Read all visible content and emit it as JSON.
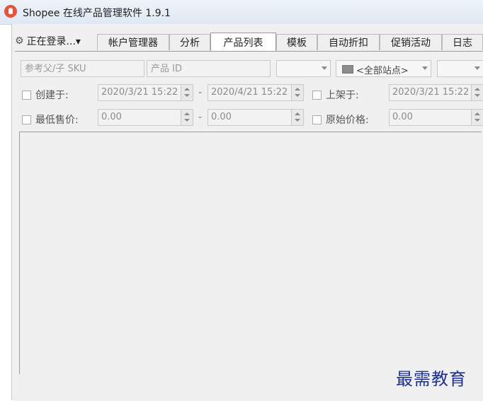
{
  "window": {
    "title": "Shopee 在线产品管理软件 1.9.1"
  },
  "menu": {
    "login_label": "正在登录...▾"
  },
  "tabs": [
    {
      "label": "帐户管理器",
      "active": false
    },
    {
      "label": "分析",
      "active": false
    },
    {
      "label": "产品列表",
      "active": true
    },
    {
      "label": "模板",
      "active": false
    },
    {
      "label": "自动折扣",
      "active": false
    },
    {
      "label": "促销活动",
      "active": false
    },
    {
      "label": "日志",
      "active": false
    }
  ],
  "filters": {
    "sku_placeholder": "参考父/子 SKU",
    "product_id_placeholder": "产品 ID",
    "site_select": "<全部站点>",
    "created_label": "创建于:",
    "created_from": "2020/3/21 15:22",
    "created_to": "2020/4/21 15:22",
    "listed_label": "上架于:",
    "listed_from": "2020/3/21 15:22",
    "min_price_label": "最低售价:",
    "min_price_from": "0.00",
    "min_price_to": "0.00",
    "orig_price_label": "原始价格:",
    "orig_price_value": "0.00"
  },
  "watermark": "最需教育",
  "colors": {
    "logo": "#e5533d",
    "watermark": "#1b2f9c"
  },
  "icons": [
    "app-logo-icon",
    "gear-icon",
    "flag-icon",
    "chevron-down-icon"
  ]
}
